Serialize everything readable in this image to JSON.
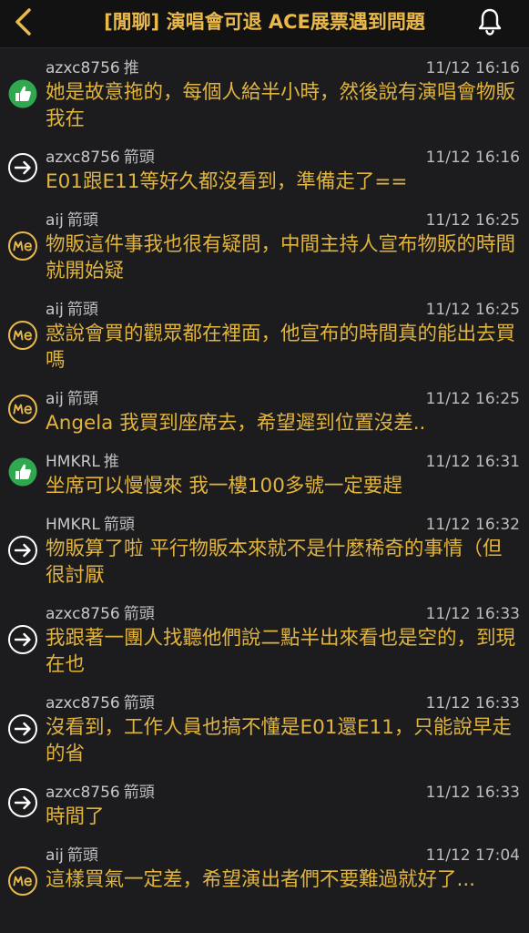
{
  "header": {
    "title": "[閒聊] 演唱會可退 ACE展票遇到問題"
  },
  "comments": [
    {
      "user": "azxc8756",
      "tag": "推",
      "time": "11/12 16:16",
      "icon": "thumbs-up-icon",
      "text": "她是故意拖的，每個人給半小時，然後說有演唱會物販我在"
    },
    {
      "user": "azxc8756",
      "tag": "箭頭",
      "time": "11/12 16:16",
      "icon": "arrow-icon",
      "text": "E01跟E11等好久都沒看到，準備走了=="
    },
    {
      "user": "aij",
      "tag": "箭頭",
      "time": "11/12 16:25",
      "icon": "me-badge-icon",
      "text": "物販這件事我也很有疑問，中間主持人宣布物販的時間就開始疑"
    },
    {
      "user": "aij",
      "tag": "箭頭",
      "time": "11/12 16:25",
      "icon": "me-badge-icon",
      "text": "惑說會買的觀眾都在裡面，他宣布的時間真的能出去買嗎"
    },
    {
      "user": "aij",
      "tag": "箭頭",
      "time": "11/12 16:25",
      "icon": "me-badge-icon",
      "text": "Angela 我買到座席去，希望遲到位置沒差.."
    },
    {
      "user": "HMKRL",
      "tag": "推",
      "time": "11/12 16:31",
      "icon": "thumbs-up-icon",
      "text": "坐席可以慢慢來 我一樓100多號一定要趕"
    },
    {
      "user": "HMKRL",
      "tag": "箭頭",
      "time": "11/12 16:32",
      "icon": "arrow-icon",
      "text": "物販算了啦 平行物販本來就不是什麼稀奇的事情（但很討厭"
    },
    {
      "user": "azxc8756",
      "tag": "箭頭",
      "time": "11/12 16:33",
      "icon": "arrow-icon",
      "text": "我跟著一團人找聽他們說二點半出來看也是空的，到現在也"
    },
    {
      "user": "azxc8756",
      "tag": "箭頭",
      "time": "11/12 16:33",
      "icon": "arrow-icon",
      "text": "沒看到，工作人員也搞不懂是E01還E11，只能說早走的省"
    },
    {
      "user": "azxc8756",
      "tag": "箭頭",
      "time": "11/12 16:33",
      "icon": "arrow-icon",
      "text": "時間了"
    },
    {
      "user": "aij",
      "tag": "箭頭",
      "time": "11/12 17:04",
      "icon": "me-badge-icon",
      "text": "這樣買氣一定差，希望演出者們不要難過就好了..."
    }
  ],
  "colors": {
    "accent": "#e9b949",
    "comment_text": "#e0b43e",
    "thumbs_up": "#2fa84f",
    "background": "#1c1c1e"
  }
}
